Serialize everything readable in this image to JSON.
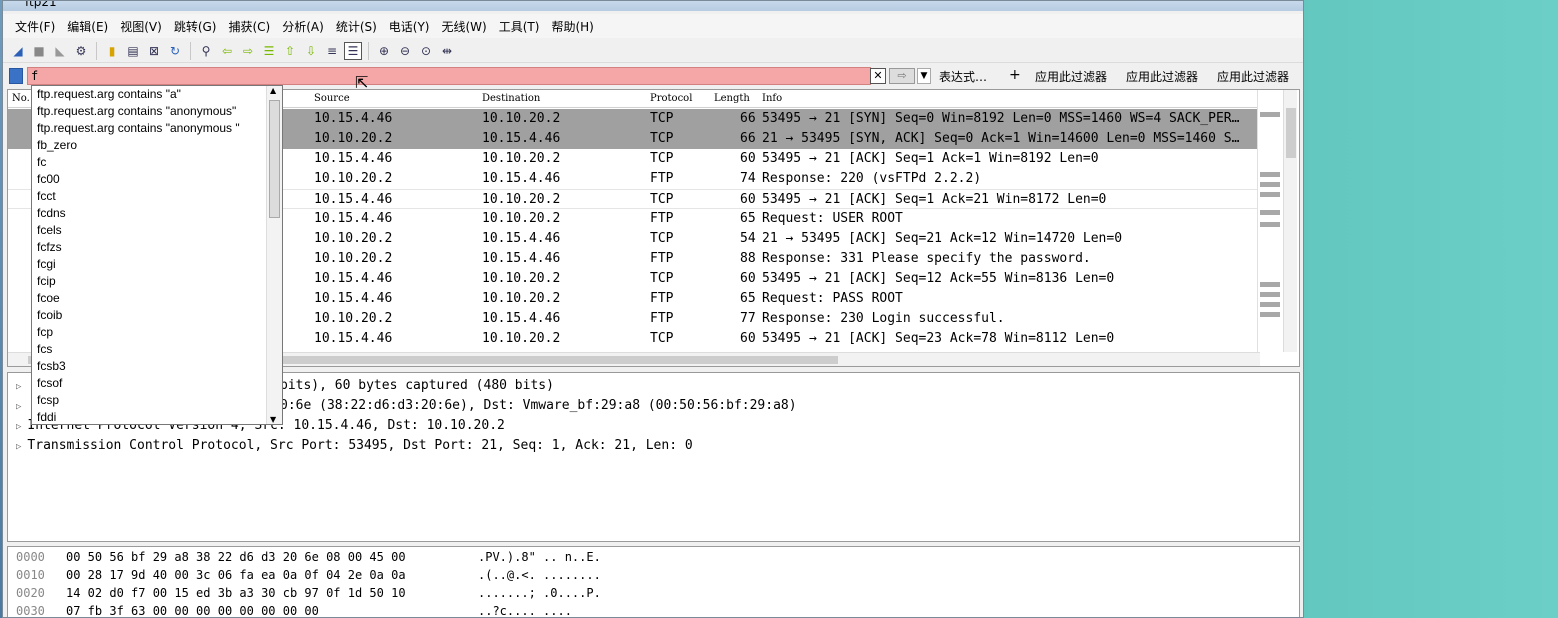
{
  "window": {
    "title": "ftp21"
  },
  "menu": [
    "文件(F)",
    "编辑(E)",
    "视图(V)",
    "跳转(G)",
    "捕获(C)",
    "分析(A)",
    "统计(S)",
    "电话(Y)",
    "无线(W)",
    "工具(T)",
    "帮助(H)"
  ],
  "toolbar_icons": [
    "shark-fin-icon",
    "stop-icon",
    "restart-icon",
    "options-icon",
    "open-icon",
    "save-icon",
    "close-file-icon",
    "reload-icon",
    "find-icon",
    "back-icon",
    "forward-icon",
    "goto-icon",
    "first-icon",
    "last-icon",
    "autoscroll-icon",
    "colorize-icon",
    "zoom-in-icon",
    "zoom-out-icon",
    "zoom-normal-icon",
    "resize-columns-icon"
  ],
  "filter": {
    "value": "f",
    "expression_label": "表达式…",
    "add_label": "+",
    "apply_buttons": [
      "应用此过滤器",
      "应用此过滤器",
      "应用此过滤器"
    ]
  },
  "columns": {
    "no": "No.",
    "source": "Source",
    "destination": "Destination",
    "protocol": "Protocol",
    "length": "Length",
    "info": "Info"
  },
  "packets": [
    {
      "source": "10.15.4.46",
      "destination": "10.10.20.2",
      "protocol": "TCP",
      "length": "66",
      "info": "53495 → 21 [SYN] Seq=0 Win=8192 Len=0 MSS=1460 WS=4 SACK_PER…"
    },
    {
      "source": "10.10.20.2",
      "destination": "10.15.4.46",
      "protocol": "TCP",
      "length": "66",
      "info": "21 → 53495 [SYN, ACK] Seq=0 Ack=1 Win=14600 Len=0 MSS=1460 S…"
    },
    {
      "source": "10.15.4.46",
      "destination": "10.10.20.2",
      "protocol": "TCP",
      "length": "60",
      "info": "53495 → 21 [ACK] Seq=1 Ack=1 Win=8192 Len=0"
    },
    {
      "source": "10.10.20.2",
      "destination": "10.15.4.46",
      "protocol": "FTP",
      "length": "74",
      "info": "Response: 220 (vsFTPd 2.2.2)"
    },
    {
      "source": "10.15.4.46",
      "destination": "10.10.20.2",
      "protocol": "TCP",
      "length": "60",
      "info": "53495 → 21 [ACK] Seq=1 Ack=21 Win=8172 Len=0"
    },
    {
      "source": "10.15.4.46",
      "destination": "10.10.20.2",
      "protocol": "FTP",
      "length": "65",
      "info": "Request: USER ROOT"
    },
    {
      "source": "10.10.20.2",
      "destination": "10.15.4.46",
      "protocol": "TCP",
      "length": "54",
      "info": "21 → 53495 [ACK] Seq=21 Ack=12 Win=14720 Len=0"
    },
    {
      "source": "10.10.20.2",
      "destination": "10.15.4.46",
      "protocol": "FTP",
      "length": "88",
      "info": "Response: 331 Please specify the password."
    },
    {
      "source": "10.15.4.46",
      "destination": "10.10.20.2",
      "protocol": "TCP",
      "length": "60",
      "info": "53495 → 21 [ACK] Seq=12 Ack=55 Win=8136 Len=0"
    },
    {
      "source": "10.15.4.46",
      "destination": "10.10.20.2",
      "protocol": "FTP",
      "length": "65",
      "info": "Request: PASS ROOT"
    },
    {
      "source": "10.10.20.2",
      "destination": "10.15.4.46",
      "protocol": "FTP",
      "length": "77",
      "info": "Response: 230 Login successful."
    },
    {
      "source": "10.15.4.46",
      "destination": "10.10.20.2",
      "protocol": "TCP",
      "length": "60",
      "info": "53495 → 21 [ACK] Seq=23 Ack=78 Win=8112 Len=0"
    }
  ],
  "autocomplete": [
    "ftp.request.arg contains \"a\"",
    "ftp.request.arg contains \"anonymous\"",
    "ftp.request.arg contains \"anonymous \"",
    "fb_zero",
    "fc",
    "fc00",
    "fcct",
    "fcdns",
    "fcels",
    "fcfzs",
    "fcgi",
    "fcip",
    "fcoe",
    "fcoib",
    "fcp",
    "fcs",
    "fcsb3",
    "fcsof",
    "fcsp",
    "fddi"
  ],
  "details": [
    "bits), 60 bytes captured (480 bits)",
    "0:6e (38:22:d6:d3:20:6e), Dst: Vmware_bf:29:a8 (00:50:56:bf:29:a8)",
    "Internet Protocol Version 4, Src: 10.15.4.46, Dst: 10.10.20.2",
    "Transmission Control Protocol, Src Port: 53495, Dst Port: 21, Seq: 1, Ack: 21, Len: 0"
  ],
  "hex": [
    {
      "offset": "0000",
      "bytes": "00 50 56 bf 29 a8 38 22  d6 d3 20 6e 08 00 45 00",
      "ascii": ".PV.).8\" .. n..E."
    },
    {
      "offset": "0010",
      "bytes": "00 28 17 9d 40 00 3c 06  fa ea 0a 0f 04 2e 0a 0a",
      "ascii": ".(..@.<. ........"
    },
    {
      "offset": "0020",
      "bytes": "14 02 d0 f7 00 15 ed 3b  a3 30 cb 97 0f 1d 50 10",
      "ascii": ".......; .0....P."
    },
    {
      "offset": "0030",
      "bytes": "07 fb 3f 63 00 00 00 00  00 00 00 00",
      "ascii": "..?c.... ...."
    }
  ]
}
